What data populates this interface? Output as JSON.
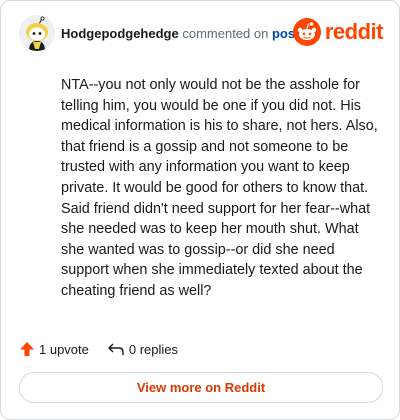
{
  "comment": {
    "username": "Hodgepodgehedge",
    "action_text": "commented on",
    "post_link": "post",
    "body": "NTA--you not only would not be the asshole for telling him, you would be one if you did not. His medical information is his to share, not hers. Also, that friend is a gossip and not someone to be trusted with any information you want to keep private. It would be good for others to know that. Said friend didn't need support for her fear--what she needed was to keep her mouth shut. What she wanted was to gossip--or did she need support when she immediately texted about the cheating friend as well?",
    "upvotes_label": "1 upvote",
    "replies_label": "0 replies"
  },
  "brand": {
    "wordmark": "reddit",
    "color": "#ff4500"
  },
  "footer": {
    "view_more_label": "View more on Reddit"
  },
  "icons": {
    "avatar": "snoo-avatar-icon",
    "logo": "reddit-logo-icon",
    "upvote": "upvote-arrow-icon",
    "reply": "reply-arrow-icon"
  }
}
